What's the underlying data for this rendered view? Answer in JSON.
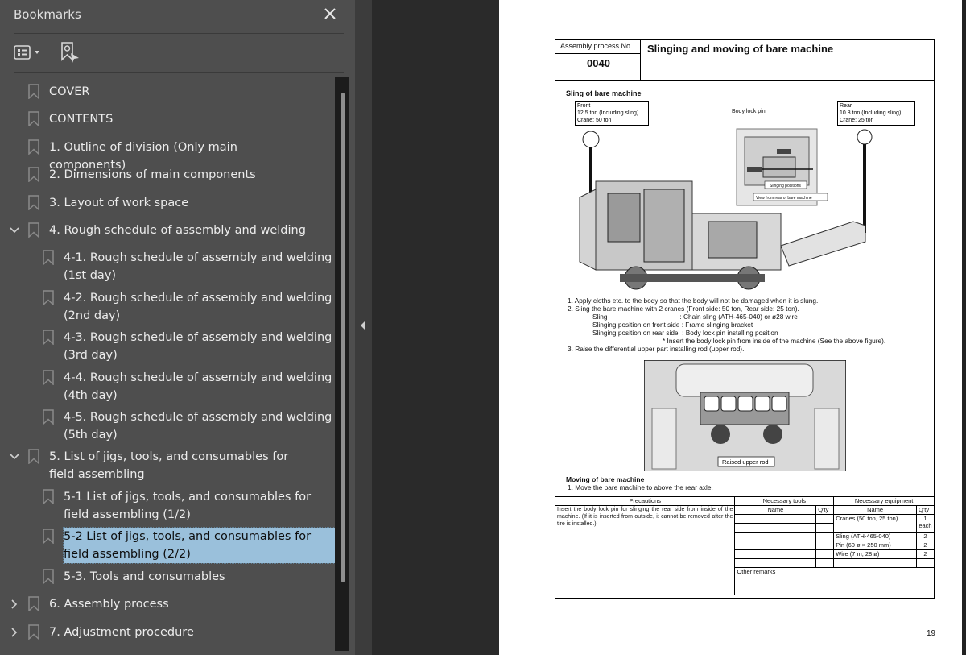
{
  "bookmarks_panel": {
    "title": "Bookmarks",
    "close_icon": "close-icon",
    "toolbar": {
      "options_icon": "list-options-icon",
      "find_icon": "find-current-bookmark-icon"
    },
    "items": [
      {
        "label": "COVER",
        "level": 0,
        "expander": "none"
      },
      {
        "label": "CONTENTS",
        "level": 0,
        "expander": "none"
      },
      {
        "label": "1. Outline of division (Only main components)",
        "level": 0,
        "expander": "none"
      },
      {
        "label": "2. Dimensions of main components",
        "level": 0,
        "expander": "none"
      },
      {
        "label": "3. Layout of work space",
        "level": 0,
        "expander": "none"
      },
      {
        "label": "4. Rough schedule of assembly and welding",
        "level": 0,
        "expander": "expanded"
      },
      {
        "label": "4-1. Rough schedule of assembly and welding (1st day)",
        "level": 1,
        "expander": "none"
      },
      {
        "label": "4-2. Rough schedule of assembly and welding (2nd day)",
        "level": 1,
        "expander": "none"
      },
      {
        "label": "4-3. Rough schedule of assembly and welding (3rd day)",
        "level": 1,
        "expander": "none"
      },
      {
        "label": "4-4. Rough schedule of assembly and welding (4th day)",
        "level": 1,
        "expander": "none"
      },
      {
        "label": "4-5. Rough schedule of assembly and welding (5th day)",
        "level": 1,
        "expander": "none"
      },
      {
        "label": "5. List of jigs, tools, and consumables for field assembling",
        "level": 0,
        "expander": "expanded"
      },
      {
        "label": "5-1 List of jigs, tools, and consumables for field assembling (1/2)",
        "level": 1,
        "expander": "none"
      },
      {
        "label": "5-2 List of jigs, tools, and consumables for field assembling (2/2)",
        "level": 1,
        "expander": "none",
        "selected": true
      },
      {
        "label": "5-3. Tools and consumables",
        "level": 1,
        "expander": "none"
      },
      {
        "label": "6. Assembly process",
        "level": 0,
        "expander": "collapsed"
      },
      {
        "label": "7. Adjustment procedure",
        "level": 0,
        "expander": "collapsed"
      }
    ],
    "selection_color": "#9ac0db"
  },
  "document": {
    "header": {
      "process_no_label": "Assembly process No.",
      "process_no": "0040",
      "title": "Slinging and moving of bare machine"
    },
    "sling_section": {
      "heading": "Sling of bare machine",
      "front_box": [
        "Front",
        "12.5 ton (Including sling)",
        "Crane: 50 ton"
      ],
      "rear_box": [
        "Rear",
        "10.8 ton (Including sling)",
        "Crane: 25 ton"
      ],
      "body_lock_pin_label": "Body lock pin",
      "slinging_positions_label": "Slinging positions",
      "view_label": "View from rear of bare machine"
    },
    "steps": [
      "1.   Apply cloths etc. to the body so that the body will not be damaged when it is slung.",
      "2.   Sling the bare machine with 2 cranes (Front side: 50 ton, Rear side: 25 ton).",
      "Sling                                       : Chain sling (ATH-465-040) or ø28 wire",
      "Slinging position on front side : Frame slinging bracket",
      "Slinging position on rear side  : Body lock pin installing position",
      "* Insert the body lock pin from inside of the machine (See the above figure).",
      "3.   Raise the differential upper part installing rod (upper rod)."
    ],
    "raised_rod_label": "Raised upper rod",
    "moving_section": {
      "heading": "Moving of bare machine",
      "step": "1.   Move the bare machine to above the rear axle."
    },
    "requirements_table": {
      "precautions_header": "Precautions",
      "tools_header": "Necessary tools",
      "equipment_header": "Necessary equipment",
      "name_header": "Name",
      "qty_header": "Q'ty",
      "precautions_text": "Insert the body lock pin for slinging the rear side from inside of the machine.  (If it is inserted from outside, it cannot be removed after the tire is installed.)",
      "equipment": [
        {
          "name": "Cranes (50 ton, 25 ton)",
          "qty": "1 each"
        },
        {
          "name": "Sling (ATH-465-040)",
          "qty": "2"
        },
        {
          "name": "Pin (60 ø × 250 mm)",
          "qty": "2"
        },
        {
          "name": "Wire (7 m, 28 ø)",
          "qty": "2"
        }
      ],
      "other_remarks_label": "Other remarks"
    },
    "page_number": "19"
  }
}
